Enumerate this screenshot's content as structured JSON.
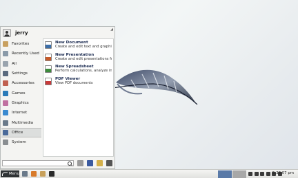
{
  "user": {
    "name": "jerry"
  },
  "categories": [
    {
      "label": "Favorites",
      "icon": "star-icon",
      "color": "#c8a060"
    },
    {
      "label": "Recently Used",
      "icon": "recent-icon",
      "color": "#8a9aa8"
    },
    {
      "label": "All",
      "icon": "all-apps-icon",
      "color": "#9aa4ae"
    },
    {
      "label": "Settings",
      "icon": "settings-icon",
      "color": "#5a6a7e"
    },
    {
      "label": "Accessories",
      "icon": "accessories-icon",
      "color": "#c06050"
    },
    {
      "label": "Games",
      "icon": "games-icon",
      "color": "#2a7ab8"
    },
    {
      "label": "Graphics",
      "icon": "graphics-icon",
      "color": "#c070a0"
    },
    {
      "label": "Internet",
      "icon": "internet-icon",
      "color": "#3a8ad0"
    },
    {
      "label": "Multimedia",
      "icon": "multimedia-icon",
      "color": "#6a7a8a"
    },
    {
      "label": "Office",
      "icon": "office-icon",
      "color": "#4a6a9a",
      "active": true
    },
    {
      "label": "System",
      "icon": "system-icon",
      "color": "#8a8e92"
    }
  ],
  "apps": [
    {
      "name": "New Document",
      "desc": "Create and edit text and graphics ...",
      "icon": "document-icon",
      "color": "#3b6ea8"
    },
    {
      "name": "New Presentation",
      "desc": "Create and edit presentations for ...",
      "icon": "presentation-icon",
      "color": "#c65a2a"
    },
    {
      "name": "New Spreadsheet",
      "desc": "Perform calculations, analyze info...",
      "icon": "spreadsheet-icon",
      "color": "#3c8c3c"
    },
    {
      "name": "PDF Viewer",
      "desc": "View PDF documents",
      "icon": "pdf-icon",
      "color": "#c83a3a"
    }
  ],
  "search": {
    "placeholder": ""
  },
  "menu_actions": [
    {
      "icon": "screensaver-icon",
      "color": "#9a9a9a"
    },
    {
      "icon": "monitor-icon",
      "color": "#3a5aa0"
    },
    {
      "icon": "lock-icon",
      "color": "#d4b04a"
    },
    {
      "icon": "power-icon",
      "color": "#555555"
    }
  ],
  "taskbar": {
    "menu_label": "Menu",
    "launchers": [
      {
        "icon": "files-icon",
        "color": "#6a7a8a"
      },
      {
        "icon": "firefox-icon",
        "color": "#d87a2a"
      },
      {
        "icon": "folder-icon",
        "color": "#c8a05a"
      },
      {
        "icon": "terminal-icon",
        "color": "#2a2a2a"
      }
    ],
    "workspaces": [
      {
        "color": "#5a7aa8",
        "active": true
      },
      {
        "color": "#a8a8a8",
        "active": false
      }
    ],
    "tray": [
      "keyboard-icon",
      "battery-icon",
      "clipboard-icon",
      "network-icon",
      "volume-icon",
      "mail-icon"
    ],
    "clock": "5:38:07 pm"
  }
}
